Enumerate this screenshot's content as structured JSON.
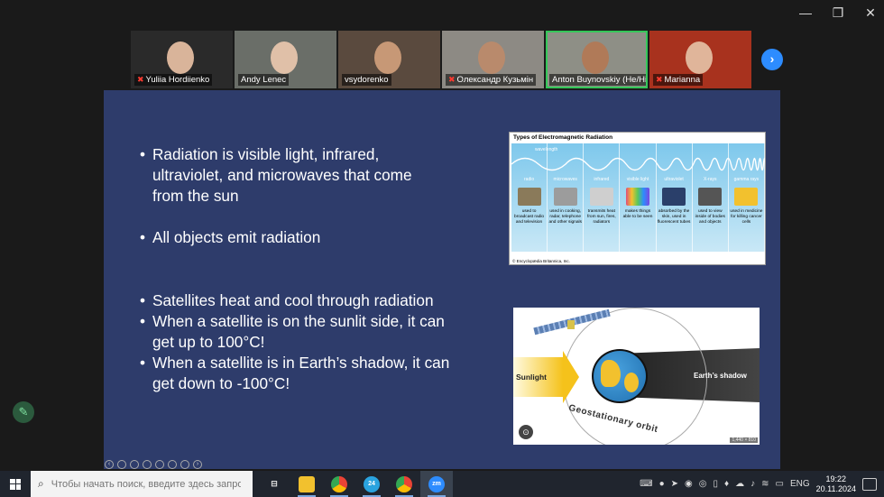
{
  "window": {
    "controls": {
      "minimize": "—",
      "restore": "❐",
      "close": "✕"
    }
  },
  "participants": [
    {
      "name": "Yuliia Hordiienko",
      "muted": true,
      "bg": "#2a2a2a",
      "face": "#d9b49a"
    },
    {
      "name": "Andy Lenec",
      "muted": false,
      "bg": "#6a6e68",
      "face": "#e0c0a8"
    },
    {
      "name": "vsydorenko",
      "muted": false,
      "bg": "#5a4a3e",
      "face": "#c79876"
    },
    {
      "name": "Олександр Кузьмін",
      "muted": true,
      "bg": "#8d8a84",
      "face": "#b98a6c"
    },
    {
      "name": "Anton Buynovskiy (He/Hi...",
      "muted": false,
      "bg": "#8e8f86",
      "face": "#b07a58",
      "active": true
    },
    {
      "name": "Marianna",
      "muted": true,
      "bg": "#a8321e",
      "face": "#e0b59a"
    }
  ],
  "next_button": "›",
  "slide": {
    "group1": [
      "Radiation is visible light, infrared, ultraviolet, and microwaves that come from the sun"
    ],
    "group2": [
      "All objects emit radiation"
    ],
    "group3": [
      "Satellites heat and cool through radiation",
      "When a satellite is on the sunlit side, it can get up to 100°C!",
      "When a satellite is in Earth’s shadow, it can get down to -100°C!"
    ],
    "em_chart": {
      "title": "Types of Electromagnetic Radiation",
      "wavelength": "wavelength",
      "footer": "© Encyclopædia Britannica, Inc.",
      "columns": [
        {
          "label": "radio",
          "desc": "used to broadcast radio and television",
          "color": "#8a7a5a"
        },
        {
          "label": "microwaves",
          "desc": "used in cooking, radar, telephone and other signals",
          "color": "#9c9c9c"
        },
        {
          "label": "infrared",
          "desc": "transmits heat from sun, fires, radiators",
          "color": "#cfcfcf"
        },
        {
          "label": "visible light",
          "desc": "makes things able to be seen",
          "color": "#e0507a"
        },
        {
          "label": "ultraviolet",
          "desc": "absorbed by the skin, used in fluorescent tubes",
          "color": "#2a3f6a"
        },
        {
          "label": "X-rays",
          "desc": "used to view inside of bodies and objects",
          "color": "#555555"
        },
        {
          "label": "gamma rays",
          "desc": "used in medicine for killing cancer cells",
          "color": "#f2c12e"
        }
      ]
    },
    "orbit_image": {
      "sunlight": "Sunlight",
      "shadow": "Earth’s shadow",
      "orbit": "Geostationary orbit",
      "dimensions": "1,440 × 810"
    }
  },
  "taskbar": {
    "search_placeholder": "Чтобы начать поиск, введите здесь запрос",
    "telegram_badge": "24",
    "lang": "ENG",
    "time": "19:22",
    "date": "20.11.2024"
  }
}
